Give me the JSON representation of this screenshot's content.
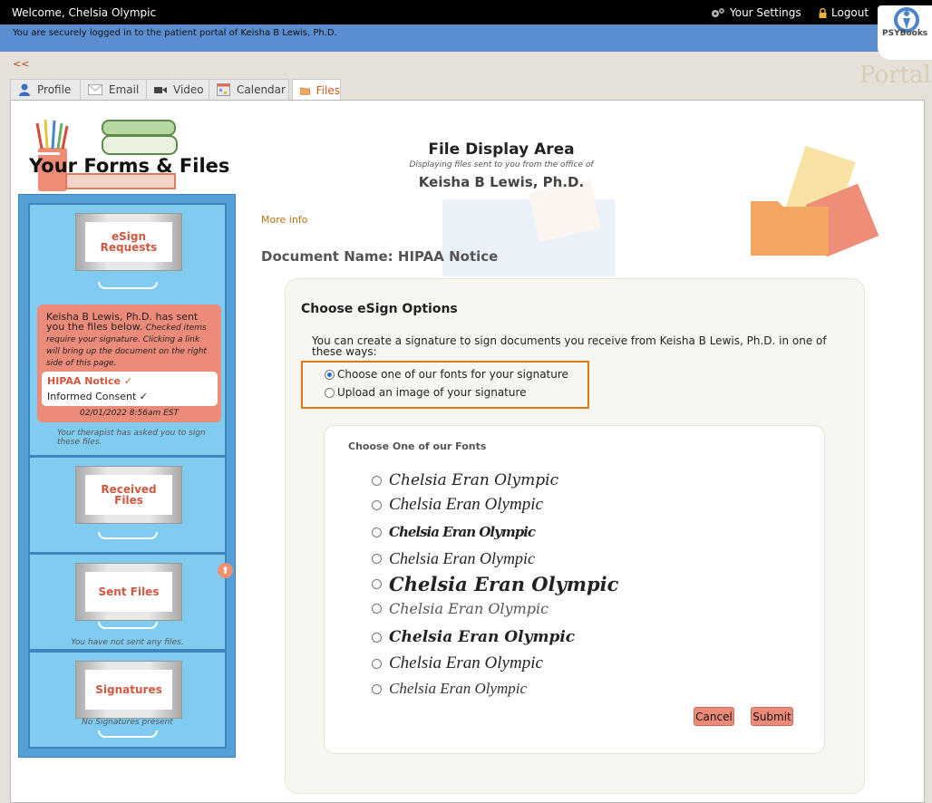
{
  "topbar": {
    "welcome": "Welcome, Chelsia Olympic",
    "settings_label": "Your Settings",
    "logout_label": "Logout"
  },
  "banner": {
    "text": "You are securely logged in to the patient portal of Keisha B Lewis, Ph.D."
  },
  "logo": {
    "text": "PSYBooks"
  },
  "nav": {
    "back": "<<",
    "portal": "Portal"
  },
  "tabs": [
    {
      "label": "Profile",
      "icon": "person-icon"
    },
    {
      "label": "Email",
      "icon": "envelope-icon"
    },
    {
      "label": "Video",
      "icon": "video-camera-icon"
    },
    {
      "label": "Calendar",
      "icon": "calendar-icon"
    },
    {
      "label": "Files",
      "icon": "folder-icon",
      "active": true
    }
  ],
  "sidebar": {
    "title": "Your Forms & Files",
    "esign": {
      "label": "eSign Requests",
      "message": "Keisha B Lewis, Ph.D. has sent you the files below.",
      "message_italic": "Checked items require your signature. Clicking a link will bring up the document on the right side of this page.",
      "files": [
        "HIPAA Notice ✓",
        "Informed Consent ✓"
      ],
      "date": "02/01/2022 8:56am EST",
      "note": "Your therapist has asked you to sign these files."
    },
    "received": {
      "label": "Received Files"
    },
    "sent": {
      "label": "Sent Files",
      "note": "You have not sent any files."
    },
    "signatures": {
      "label": "Signatures",
      "note": "No Signatures present"
    }
  },
  "file_area": {
    "title": "File Display Area",
    "subtitle": "Displaying files sent to you from the office of",
    "therapist": "Keisha B Lewis, Ph.D.",
    "more_info": "More info",
    "document_name": "Document Name: HIPAA Notice"
  },
  "esign_options": {
    "title": "Choose eSign Options",
    "description": "You can create a signature to sign documents you receive from Keisha B Lewis, Ph.D. in one of these ways:",
    "options": [
      {
        "label": "Choose one of our fonts for your signature",
        "selected": true
      },
      {
        "label": "Upload an image of your signature",
        "selected": false
      }
    ],
    "fonts_title": "Choose One of our Fonts",
    "signature_text": "Chelsia Eran Olympic",
    "font_choice_count": 9,
    "cancel_label": "Cancel",
    "submit_label": "Submit"
  },
  "colors": {
    "accent_orange": "#d77c12",
    "salmon": "#ec8b79",
    "sidebar_blue": "#52a0d7",
    "banner_blue": "#5a8ed0"
  }
}
